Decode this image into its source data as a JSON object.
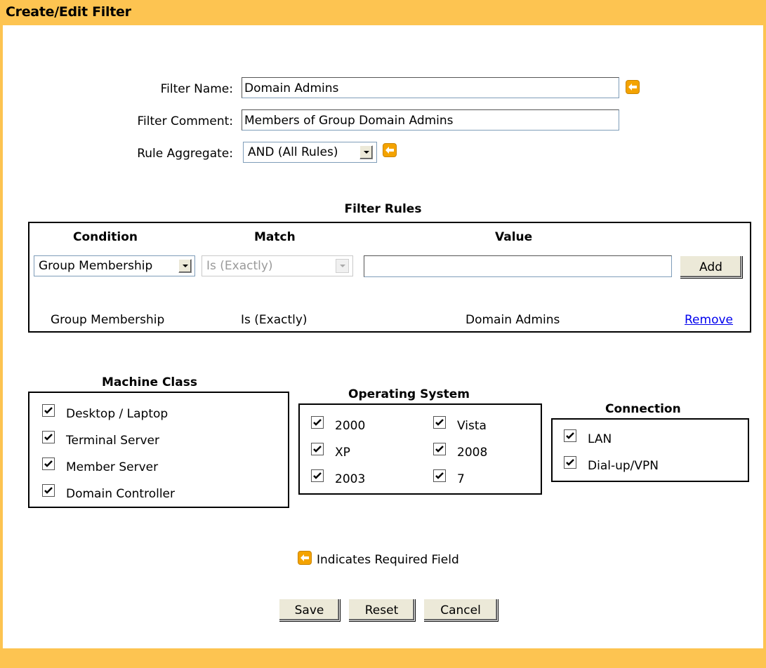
{
  "header": {
    "title": "Create/Edit Filter"
  },
  "form": {
    "filter_name_label": "Filter Name:",
    "filter_name_value": "Domain Admins",
    "filter_comment_label": "Filter Comment:",
    "filter_comment_value": "Members of Group Domain Admins",
    "rule_aggregate_label": "Rule Aggregate:",
    "rule_aggregate_value": "AND (All Rules)"
  },
  "rules": {
    "title": "Filter Rules",
    "col_condition": "Condition",
    "col_match": "Match",
    "col_value": "Value",
    "condition_select": "Group Membership",
    "match_select": "Is (Exactly)",
    "value_input": "",
    "add_label": "Add",
    "existing": [
      {
        "condition": "Group Membership",
        "match": "Is (Exactly)",
        "value": "Domain Admins",
        "action": "Remove"
      }
    ]
  },
  "machine_class": {
    "title": "Machine Class",
    "items": [
      {
        "label": "Desktop / Laptop",
        "checked": true
      },
      {
        "label": "Terminal Server",
        "checked": true
      },
      {
        "label": "Member Server",
        "checked": true
      },
      {
        "label": "Domain Controller",
        "checked": true
      }
    ]
  },
  "operating_system": {
    "title": "Operating System",
    "items": [
      {
        "label": "2000",
        "checked": true
      },
      {
        "label": "Vista",
        "checked": true
      },
      {
        "label": "XP",
        "checked": true
      },
      {
        "label": "2008",
        "checked": true
      },
      {
        "label": "2003",
        "checked": true
      },
      {
        "label": "7",
        "checked": true
      }
    ]
  },
  "connection": {
    "title": "Connection",
    "items": [
      {
        "label": "LAN",
        "checked": true
      },
      {
        "label": "Dial-up/VPN",
        "checked": true
      }
    ]
  },
  "legend": {
    "required_text": "Indicates Required Field"
  },
  "buttons": {
    "save": "Save",
    "reset": "Reset",
    "cancel": "Cancel"
  },
  "colors": {
    "frame": "#fdc451",
    "required_icon": "#f4a300",
    "link": "#0000ee"
  }
}
